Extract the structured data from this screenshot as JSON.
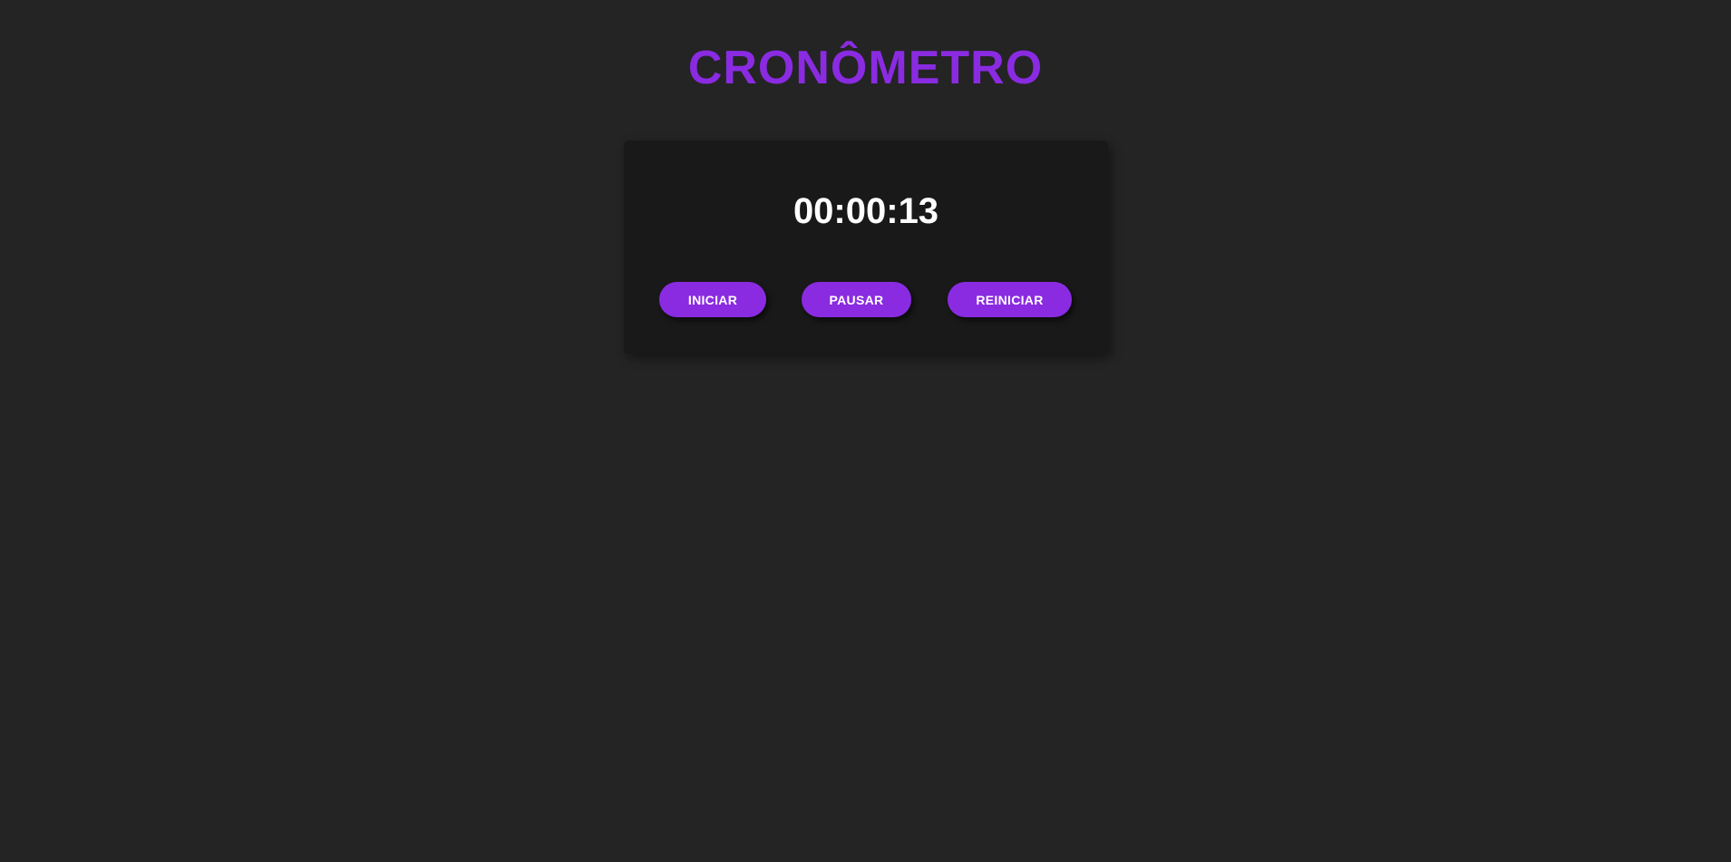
{
  "header": {
    "title": "CRONÔMETRO"
  },
  "stopwatch": {
    "display": "00:00:13",
    "buttons": {
      "start_label": "INICIAR",
      "pause_label": "PAUSAR",
      "reset_label": "REINICIAR"
    }
  },
  "colors": {
    "background": "#242424",
    "card": "#191919",
    "accent": "#8a2be2",
    "text": "#ffffff"
  }
}
